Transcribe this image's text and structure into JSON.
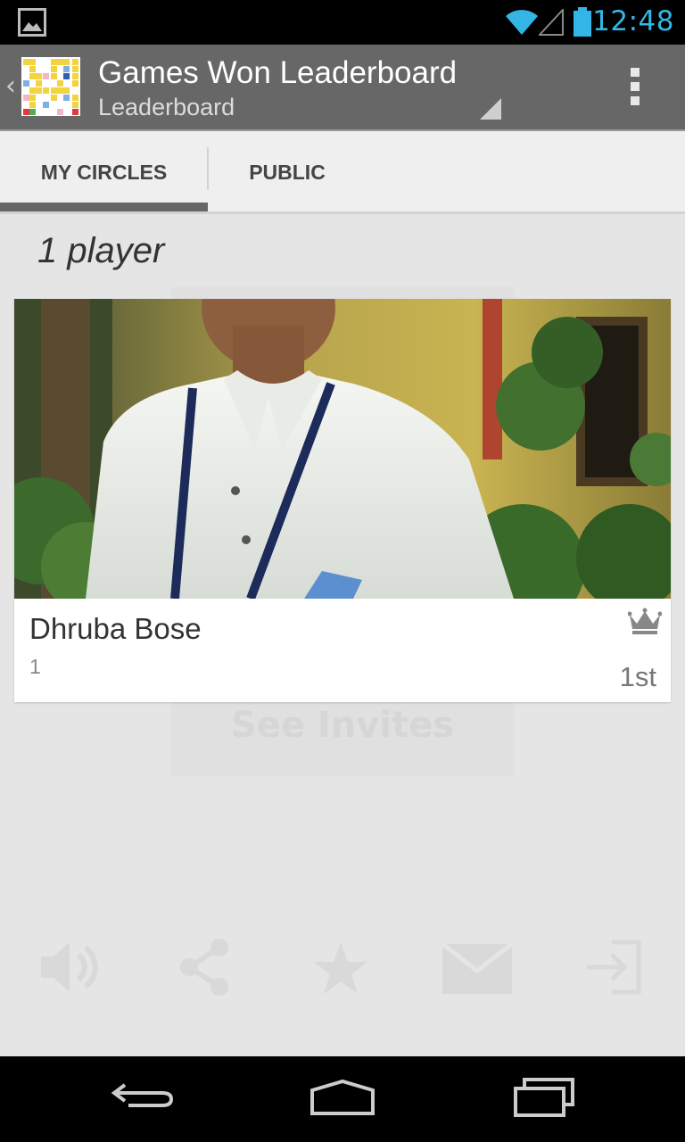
{
  "status_bar": {
    "time": "12:48",
    "icons": [
      "picture-icon",
      "wifi-icon",
      "signal-icon",
      "battery-icon"
    ],
    "accent_color": "#33b5e5"
  },
  "action_bar": {
    "title": "Games Won Leaderboard",
    "subtitle": "Leaderboard",
    "up_glyph": "‹"
  },
  "tabs": [
    {
      "label": "MY CIRCLES",
      "selected": true
    },
    {
      "label": "PUBLIC",
      "selected": false
    }
  ],
  "player_count": "1 player",
  "players": [
    {
      "name": "Dhruba Bose",
      "score": "1",
      "rank": "1st"
    }
  ],
  "background_overlay": {
    "see_invites": "See Invites",
    "icons": [
      "volume-icon",
      "share-icon",
      "star-icon",
      "mail-icon",
      "sign-in-icon"
    ]
  },
  "nav_bar": {
    "buttons": [
      "back-icon",
      "home-icon",
      "recent-apps-icon"
    ]
  }
}
